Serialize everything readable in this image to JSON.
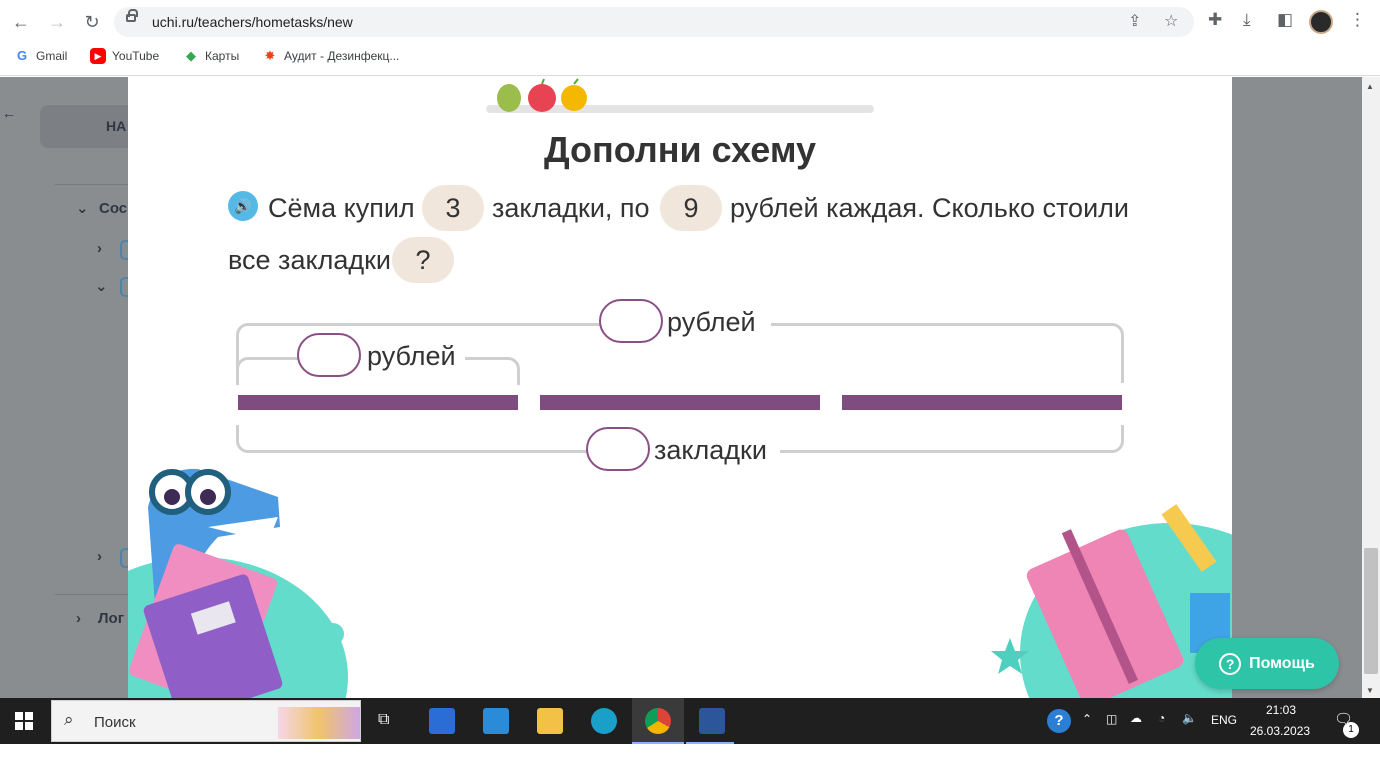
{
  "browser": {
    "url": "uchi.ru/teachers/hometasks/new",
    "bookmarks": [
      {
        "label": "Gmail",
        "icon": "gmail-icon"
      },
      {
        "label": "YouTube",
        "icon": "youtube-icon"
      },
      {
        "label": "Карты",
        "icon": "maps-icon"
      },
      {
        "label": "Аудит - Дезинфекц...",
        "icon": "audit-icon"
      }
    ]
  },
  "sidebar": {
    "back_label": "НА",
    "item1": "Сос",
    "item2": "Лог"
  },
  "task": {
    "title": "Дополни схему",
    "part1": "Сёма купил",
    "val1": "3",
    "part2": "закладки, по",
    "val2": "9",
    "part3": "рублей каждая. Сколько стоили",
    "part4": "все закладки",
    "val3": "?"
  },
  "scheme": {
    "top_label": "рублей",
    "inner_label": "рублей",
    "bottom_label": "закладки",
    "bar_count": 3,
    "bar_color": "#7f4c80",
    "slot_color": "#8a4f84"
  },
  "help_label": "Помощь",
  "taskbar": {
    "search_label": "Поиск",
    "lang": "ENG",
    "time": "21:03",
    "date": "26.03.2023",
    "notif_count": "1"
  }
}
